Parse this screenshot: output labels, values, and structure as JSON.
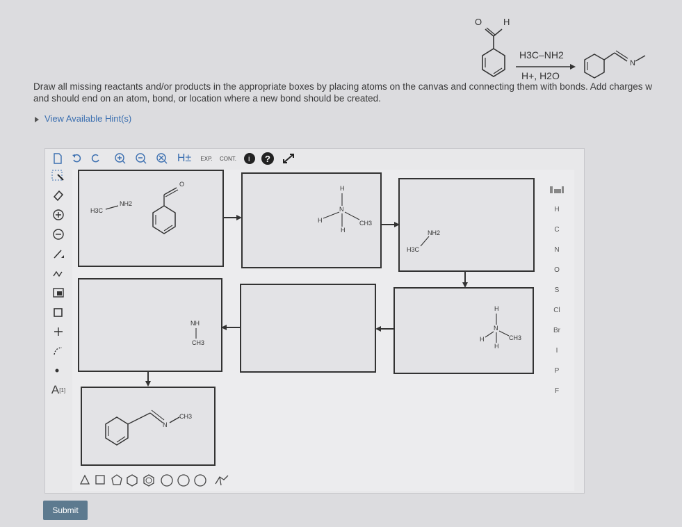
{
  "scheme": {
    "reagent_top": "H3C–NH2",
    "reagent_bottom": "H+, H2O",
    "aldehyde_O": "O",
    "aldehyde_H": "H",
    "product_N": "N"
  },
  "instructions": {
    "line1": "Draw all missing reactants and/or products in the appropriate boxes by placing atoms on the canvas and connecting them with bonds. Add charges w",
    "line2": "and should end on an atom, bond, or location where a new bond should be created."
  },
  "hint_link": "View Available Hint(s)",
  "toolbar": {
    "h_label": "H±",
    "exp_label": "EXP.",
    "cont_label": "CONT."
  },
  "left_tools": {
    "charge_label": "[1]",
    "a_label": "A"
  },
  "periodic": [
    "H",
    "C",
    "N",
    "O",
    "S",
    "Cl",
    "Br",
    "I",
    "P",
    "F"
  ],
  "boxes": {
    "b1": {
      "h3c": "H3C",
      "nh2": "NH2",
      "o": "O"
    },
    "b2": {
      "h_top": "H",
      "h_left": "H",
      "h_bottom": "H",
      "n": "N",
      "ch3": "CH3"
    },
    "b3": {
      "h3c": "H3C",
      "nh2": "NH2"
    },
    "b4": {
      "h_top": "H",
      "h_left": "H",
      "h_bottom": "H",
      "n": "N",
      "ch3": "CH3"
    },
    "b5": {
      "nh": "NH",
      "ch3": "CH3"
    },
    "b6": {
      "n": "N",
      "ch3": "CH3"
    }
  },
  "submit_label": "Submit",
  "colors": {
    "accent": "#3b6fb0",
    "submit_bg": "#5d7a8f"
  }
}
